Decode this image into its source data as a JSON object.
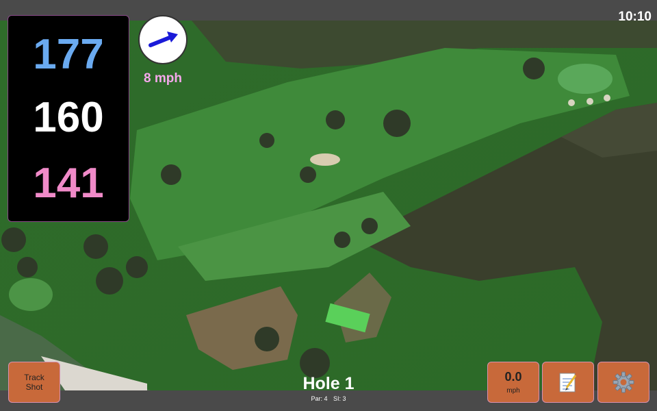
{
  "status": {
    "time": "10:10"
  },
  "distances": {
    "back": "177",
    "middle": "160",
    "front": "141"
  },
  "wind": {
    "speed_label": "8 mph"
  },
  "buttons": {
    "track_shot": "Track\nShot",
    "wind_value": "0.0",
    "wind_unit": "mph",
    "notes_icon": "notepad-icon",
    "settings_icon": "gear-icon"
  },
  "hole": {
    "title": "Hole 1",
    "par": "Par: 4",
    "si": "SI: 3"
  },
  "colors": {
    "back": "#6aaaf0",
    "middle": "#ffffff",
    "front": "#f08ac8",
    "wind_text": "#f5a8ec",
    "button": "#c8693a",
    "fairway": "#3f8a3a",
    "trees": "#2f3a28"
  }
}
